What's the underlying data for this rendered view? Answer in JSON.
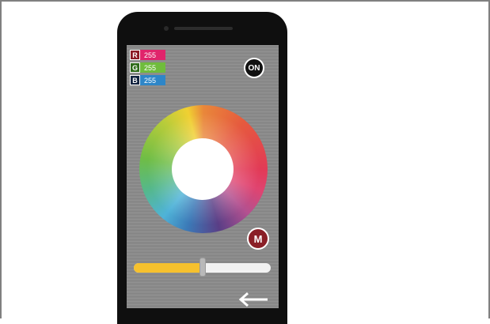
{
  "rgb": {
    "r": {
      "letter": "R",
      "value": "255",
      "letter_color": "#8b1a24",
      "value_color": "#e0246b"
    },
    "g": {
      "letter": "G",
      "value": "255",
      "letter_color": "#2f6b1a",
      "value_color": "#6fbc3c"
    },
    "b": {
      "letter": "B",
      "value": "255",
      "letter_color": "#12233f",
      "value_color": "#2e86c8"
    }
  },
  "power_button": {
    "label": "ON"
  },
  "mode_button": {
    "label": "M"
  },
  "brightness_slider": {
    "level": 0.5,
    "fill_color": "#f6c12e",
    "track_color": "#f2f2f2"
  },
  "color_wheel": {
    "center_color": "#ffffff"
  },
  "back_button": {
    "icon": "arrow-left-icon"
  }
}
